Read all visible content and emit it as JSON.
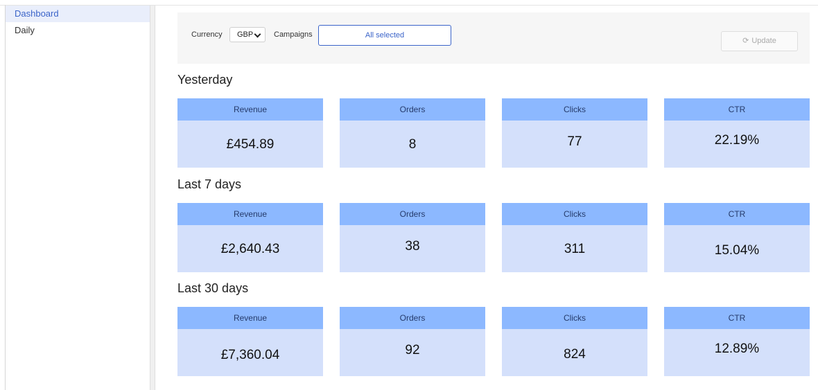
{
  "sidebar": {
    "items": [
      {
        "label": "Dashboard",
        "active": true
      },
      {
        "label": "Daily",
        "active": false
      }
    ]
  },
  "filters": {
    "currency_label": "Currency",
    "currency_value": "GBP",
    "campaigns_label": "Campaigns",
    "campaigns_value": "All selected",
    "update_label": "Update"
  },
  "sections": [
    {
      "title": "Yesterday",
      "cards": [
        {
          "label": "Revenue",
          "value": "£454.89"
        },
        {
          "label": "Orders",
          "value": "8"
        },
        {
          "label": "Clicks",
          "value": "77"
        },
        {
          "label": "CTR",
          "value": "22.19%"
        }
      ]
    },
    {
      "title": "Last 7 days",
      "cards": [
        {
          "label": "Revenue",
          "value": "£2,640.43"
        },
        {
          "label": "Orders",
          "value": "38"
        },
        {
          "label": "Clicks",
          "value": "311"
        },
        {
          "label": "CTR",
          "value": "15.04%"
        }
      ]
    },
    {
      "title": "Last 30 days",
      "cards": [
        {
          "label": "Revenue",
          "value": "£7,360.04"
        },
        {
          "label": "Orders",
          "value": "92"
        },
        {
          "label": "Clicks",
          "value": "824"
        },
        {
          "label": "CTR",
          "value": "12.89%"
        }
      ]
    }
  ],
  "colors": {
    "card_header": "#8cb8ff",
    "card_body": "#d4e0fb",
    "accent": "#3b64c9"
  }
}
